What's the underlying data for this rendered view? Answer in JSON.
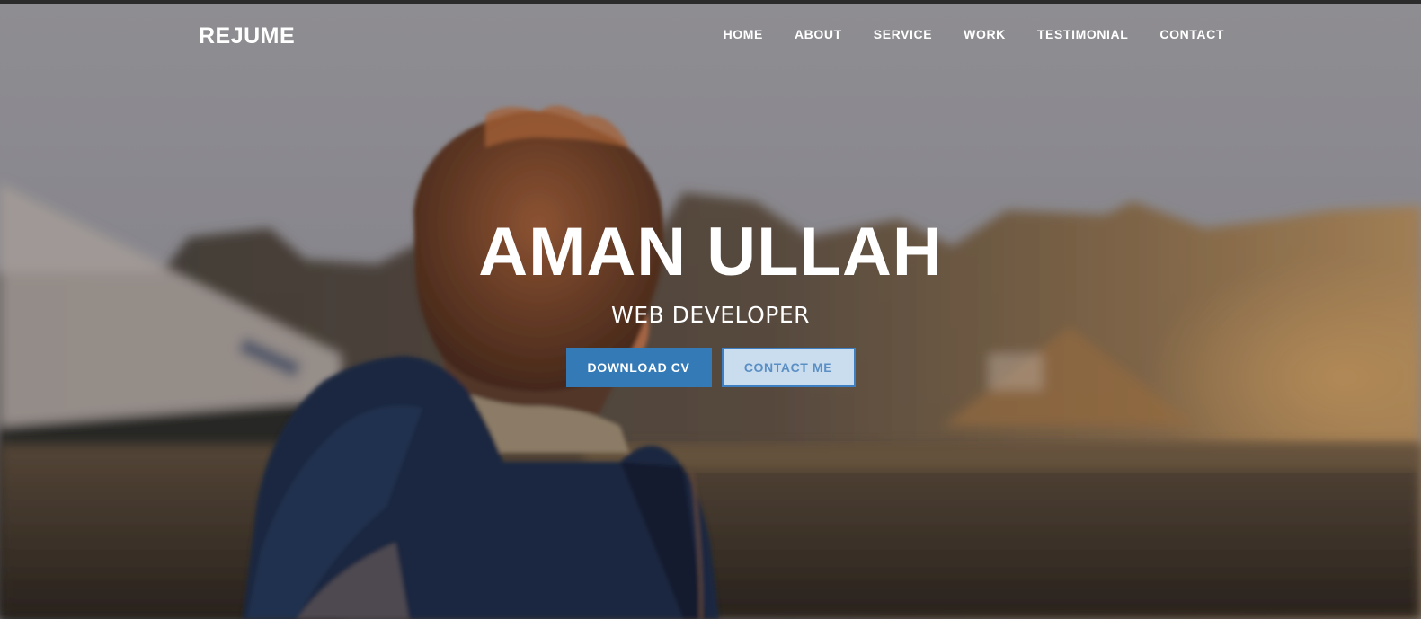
{
  "brand": {
    "name": "REJUME"
  },
  "nav": {
    "items": [
      {
        "label": "HOME"
      },
      {
        "label": "ABOUT"
      },
      {
        "label": "SERVICE"
      },
      {
        "label": "WORK"
      },
      {
        "label": "TESTIMONIAL"
      },
      {
        "label": "CONTACT"
      }
    ]
  },
  "hero": {
    "title": "AMAN ULLAH",
    "subtitle": "WEB DEVELOPER",
    "buttons": {
      "download_label": "DOWNLOAD CV",
      "contact_label": "CONTACT ME"
    }
  },
  "colors": {
    "primary": "#337ab7",
    "secondary_bg": "#c9ddef",
    "secondary_text": "#5b8fc4",
    "text": "#ffffff"
  }
}
